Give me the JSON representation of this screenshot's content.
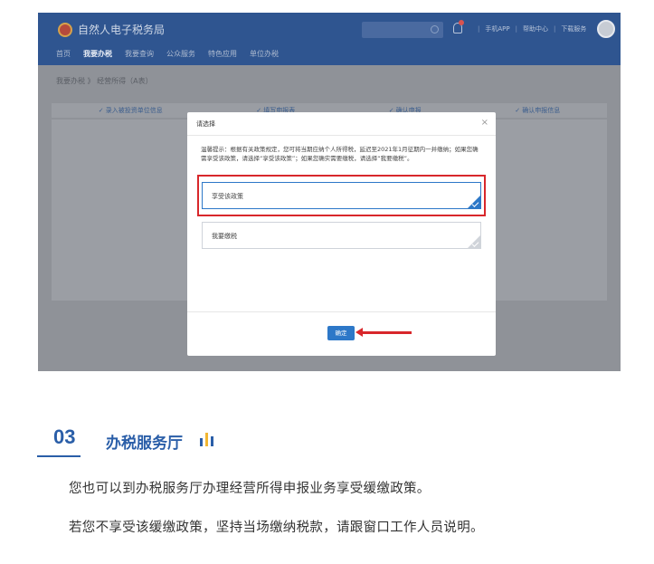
{
  "app": {
    "title": "自然人电子税务局"
  },
  "header": {
    "links": [
      "手机APP",
      "帮助中心",
      "下载服务"
    ]
  },
  "nav": {
    "items": [
      {
        "label": "首页",
        "active": false
      },
      {
        "label": "我要办税",
        "active": true
      },
      {
        "label": "我要查询",
        "active": false
      },
      {
        "label": "公众服务",
        "active": false
      },
      {
        "label": "特色应用",
        "active": false
      },
      {
        "label": "单位办税",
        "active": false
      }
    ]
  },
  "breadcrumb": {
    "root": "我要办税",
    "separator": "》",
    "current": "经营所得（A表）"
  },
  "steps": [
    "✓ 录入被投资单位信息",
    "✓ 填写申报表",
    "✓ 确认申报",
    "✓ 确认申报信息"
  ],
  "dialog": {
    "title": "请选择",
    "close": "×",
    "hint": "温馨提示：根据有关政策规定，您可将当期应纳个人所得税，延迟至2021年1月征期内一并缴纳；如果您确需享受该政策，请选择“享受该政策”；如果您确实需要缴税，请选择“我要缴税”。",
    "options": [
      {
        "label": "享受该政策",
        "selected": true
      },
      {
        "label": "我要缴税",
        "selected": false
      }
    ],
    "confirm": "确定"
  },
  "section": {
    "number": "03",
    "title": "办税服务厅",
    "paragraphs": [
      "您也可以到办税服务厅办理经营所得申报业务享受缓缴政策。",
      "若您不享受该缓缴政策，坚持当场缴纳税款，请跟窗口工作人员说明。"
    ]
  },
  "colors": {
    "brand": "#2a5ea8",
    "highlight": "#d8272b",
    "accent_blue": "#2d78c8",
    "bars": [
      "#2a5ea8",
      "#f2b632",
      "#2a5ea8"
    ]
  }
}
